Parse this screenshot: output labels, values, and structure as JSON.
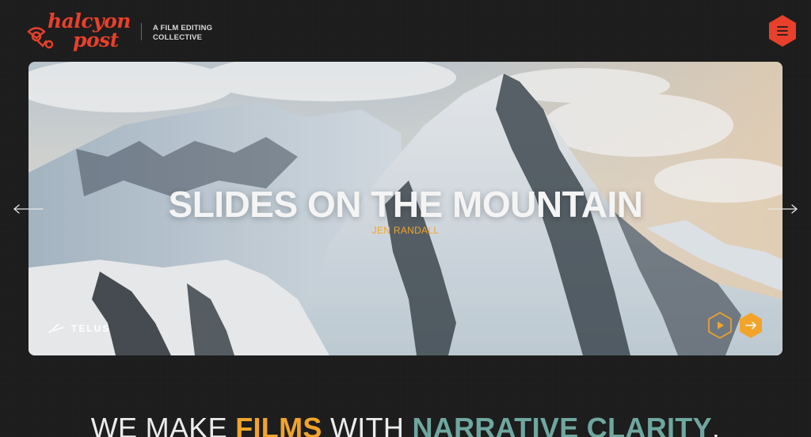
{
  "header": {
    "logo_line1": "halcyon",
    "logo_line2": "post",
    "tagline_line1": "A FILM EDITING",
    "tagline_line2": "COLLECTIVE",
    "menu_icon": "hamburger-icon"
  },
  "hero": {
    "title": "SLIDES ON THE MOUNTAIN",
    "subtitle": "JEN RANDALL",
    "sponsor": "TELUS",
    "play_icon": "play-icon",
    "next_icon": "arrow-right-icon"
  },
  "nav": {
    "prev_icon": "arrow-left-icon",
    "next_icon": "arrow-right-icon"
  },
  "headline": {
    "part1": "WE MAKE ",
    "accent1": "FILMS",
    "part2": " WITH ",
    "accent2": "NARRATIVE CLARITY",
    "part3": "."
  },
  "colors": {
    "brand_red": "#e8402b",
    "accent_orange": "#f2a42a",
    "accent_teal": "#6fa7a0",
    "background": "#1c1c1c"
  }
}
